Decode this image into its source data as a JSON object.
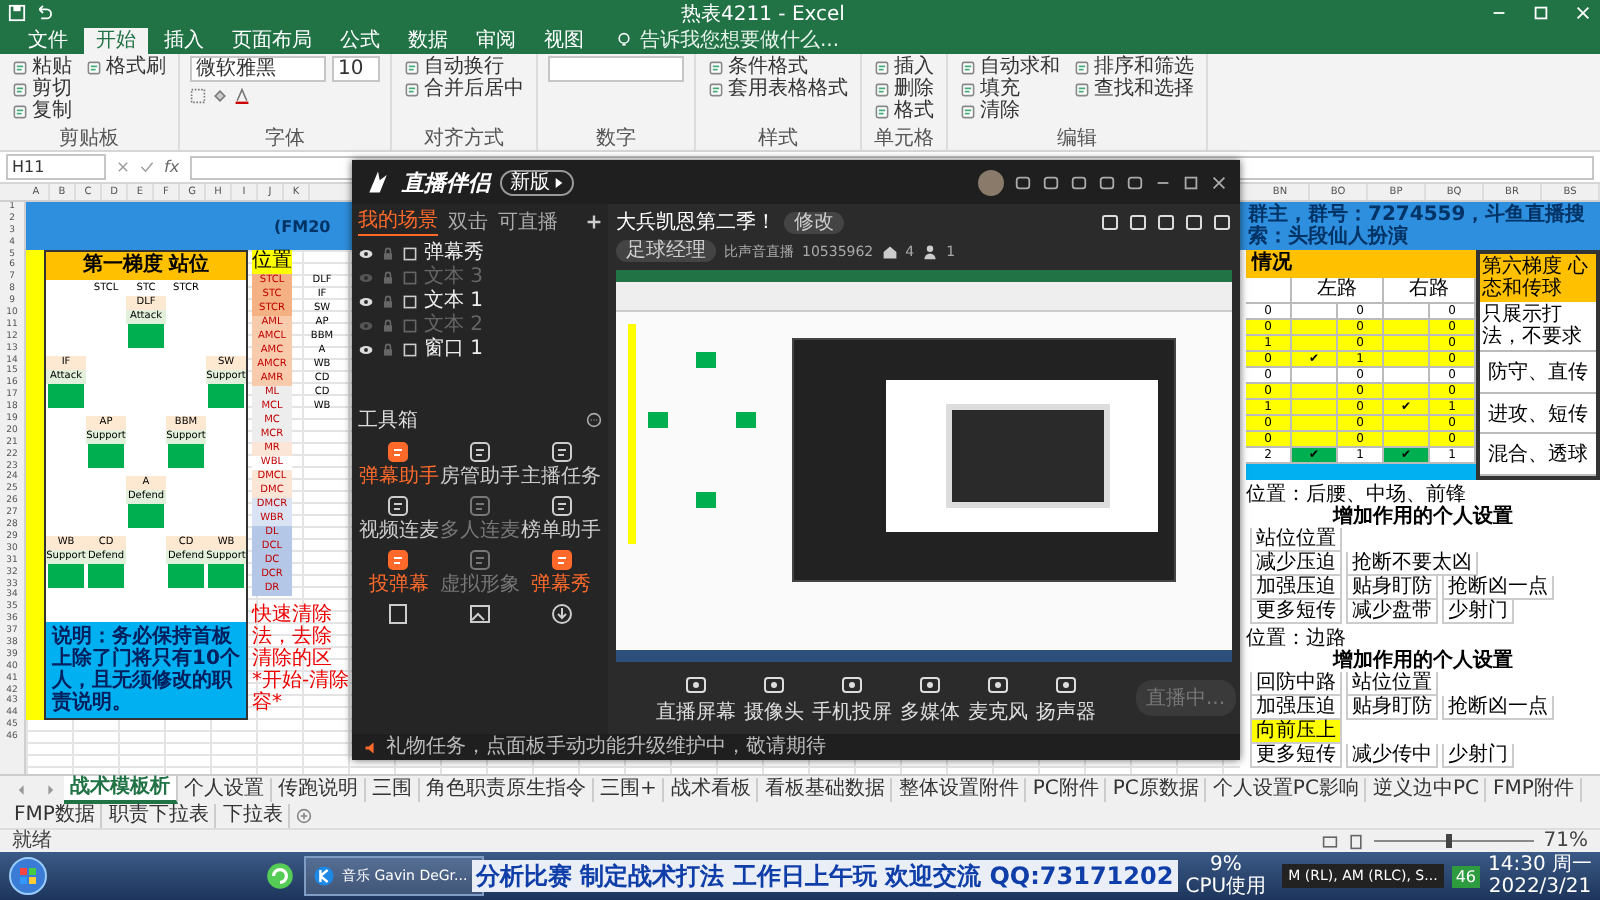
{
  "excel": {
    "title": "热表4211 - Excel",
    "tabs": [
      {
        "label": "文件",
        "selected": false
      },
      {
        "label": "开始",
        "selected": true
      },
      {
        "label": "插入",
        "selected": false
      },
      {
        "label": "页面布局",
        "selected": false
      },
      {
        "label": "公式",
        "selected": false
      },
      {
        "label": "数据",
        "selected": false
      },
      {
        "label": "审阅",
        "selected": false
      },
      {
        "label": "视图",
        "selected": false
      }
    ],
    "tell_me": "告诉我您想要做什么...",
    "ribbon_groups": [
      {
        "label": "剪贴板",
        "buttons": [
          "粘贴",
          "剪切",
          "复制",
          "格式刷"
        ]
      },
      {
        "label": "字体",
        "font": "微软雅黑",
        "size": "10"
      },
      {
        "label": "对齐方式",
        "buttons": [
          "自动换行",
          "合并后居中"
        ]
      },
      {
        "label": "数字"
      },
      {
        "label": "样式",
        "buttons": [
          "条件格式",
          "套用表格格式"
        ]
      },
      {
        "label": "单元格",
        "buttons": [
          "插入",
          "删除",
          "格式"
        ]
      },
      {
        "label": "编辑",
        "buttons": [
          "自动求和",
          "填充",
          "清除",
          "排序和筛选",
          "查找和选择"
        ]
      }
    ],
    "name_box": "H11",
    "fx": "fx",
    "columns_left": [
      "A",
      "B",
      "C",
      "D",
      "E",
      "F",
      "G",
      "H",
      "I",
      "J",
      "K"
    ],
    "columns_right": [
      "BN",
      "BO",
      "BP",
      "BQ",
      "BR",
      "BS"
    ],
    "row_numbers": [
      "1",
      "2",
      "3",
      "4",
      "5",
      "6",
      "7",
      "8",
      "9",
      "10",
      "11",
      "12",
      "13",
      "14",
      "15",
      "16",
      "17",
      "18",
      "19",
      "20",
      "21",
      "22",
      "23",
      "24",
      "25",
      "26",
      "27",
      "28",
      "29",
      "30",
      "31",
      "32",
      "33",
      "34",
      "35",
      "36",
      "37",
      "38",
      "39",
      "40",
      "41",
      "42",
      "43",
      "44",
      "45",
      "46"
    ]
  },
  "sheet": {
    "banner": {
      "left": "(FM20",
      "right": "群主，群号：7274559，斗鱼直播搜索：头段仙人扮演"
    },
    "formation": {
      "title": "第一梯度 站位",
      "header": [
        "STCL",
        "STC",
        "STCR"
      ],
      "lines": [
        {
          "cells": [
            null,
            null,
            {
              "role": "DLF",
              "duty": "Attack"
            },
            null,
            null
          ]
        },
        {
          "cells": [
            {
              "role": "IF",
              "duty": "Attack"
            },
            null,
            null,
            null,
            {
              "role": "SW",
              "duty": "Support"
            }
          ]
        },
        {
          "cells": [
            null,
            {
              "role": "AP",
              "duty": "Support"
            },
            null,
            {
              "role": "BBM",
              "duty": "Support"
            },
            null
          ]
        },
        {
          "cells": [
            null,
            null,
            {
              "role": "A",
              "duty": "Defend"
            },
            null,
            null
          ]
        },
        {
          "cells": [
            {
              "role": "WB",
              "duty": "Support"
            },
            {
              "role": "CD",
              "duty": "Defend"
            },
            null,
            {
              "role": "CD",
              "duty": "Defend"
            },
            {
              "role": "WB",
              "duty": "Support"
            }
          ]
        }
      ],
      "note": "说明：务必保持首板上除了门将只有10个人，且无须修改的职责说明。"
    },
    "positions": {
      "header": "位置",
      "items": [
        {
          "name": "STCL",
          "role": "DLF",
          "color": "#f4b183"
        },
        {
          "name": "STC",
          "role": "IF",
          "color": "#f4b183"
        },
        {
          "name": "STCR",
          "role": "SW",
          "color": "#f4b183"
        },
        {
          "name": "AML",
          "role": "AP",
          "color": "#f8cbad"
        },
        {
          "name": "AMCL",
          "role": "BBM",
          "color": "#f8cbad"
        },
        {
          "name": "AMC",
          "role": "A",
          "color": "#f8cbad"
        },
        {
          "name": "AMCR",
          "role": "WB",
          "color": "#f8cbad"
        },
        {
          "name": "AMR",
          "role": "CD",
          "color": "#f8cbad"
        },
        {
          "name": "ML",
          "role": "CD",
          "color": "#ededed"
        },
        {
          "name": "MCL",
          "role": "WB",
          "color": "#ededed"
        },
        {
          "name": "MC",
          "color": "#ededed"
        },
        {
          "name": "MCR",
          "color": "#ededed"
        },
        {
          "name": "MR",
          "color": "#fbe5d6"
        },
        {
          "name": "WBL",
          "color": "#ffffff"
        },
        {
          "name": "DMCL",
          "color": "#fbe5d6"
        },
        {
          "name": "DMC",
          "color": "#fbe5d6"
        },
        {
          "name": "DMCR",
          "color": "#dae3f3"
        },
        {
          "name": "WBR",
          "color": "#dae3f3"
        },
        {
          "name": "DL",
          "color": "#b4c7e7"
        },
        {
          "name": "DCL",
          "color": "#b4c7e7"
        },
        {
          "name": "DC",
          "color": "#b4c7e7"
        },
        {
          "name": "DCR",
          "color": "#b4c7e7"
        },
        {
          "name": "DR",
          "color": "#b4c7e7"
        }
      ]
    },
    "red_note": [
      "快速清除",
      "法，去除",
      "清除的区",
      "*开始-清除",
      "容*"
    ],
    "summary": {
      "title": "情况",
      "columns": [
        "左路",
        "右路"
      ],
      "rows": [
        {
          "kind": "plain",
          "cells": [
            "0",
            "",
            "0",
            "",
            "0"
          ]
        },
        {
          "kind": "highlight",
          "cells": [
            "0",
            "",
            "0",
            "",
            "0"
          ]
        },
        {
          "kind": "highlight",
          "cells": [
            "1",
            "",
            "0",
            "",
            "0"
          ]
        },
        {
          "kind": "highlight",
          "cells": [
            "0",
            "✔",
            "1",
            "",
            "0"
          ]
        },
        {
          "kind": "plain",
          "cells": [
            "0",
            "",
            "0",
            "",
            "0"
          ]
        },
        {
          "kind": "highlight",
          "cells": [
            "0",
            "",
            "0",
            "",
            "0"
          ]
        },
        {
          "kind": "highlight",
          "cells": [
            "1",
            "",
            "0",
            "✔",
            "1"
          ]
        },
        {
          "kind": "highlight",
          "cells": [
            "0",
            "",
            "0",
            "",
            "0"
          ]
        },
        {
          "kind": "highlight",
          "cells": [
            "0",
            "",
            "0",
            "",
            "0"
          ]
        },
        {
          "kind": "total",
          "cells": [
            "2",
            "✔",
            "1",
            "✔",
            "1"
          ]
        }
      ]
    },
    "styles_panel": {
      "title": "第六梯度 心态和传球",
      "hint": "只展示打法，不要求",
      "styles": [
        "防守、直传",
        "进攻、短传",
        "混合、透球"
      ]
    },
    "sections": [
      {
        "position": "位置：后腰、中场、前锋",
        "header": "增加作用的个人设置",
        "rows": [
          {
            "cells": [
              {
                "text": "站位位置",
                "highlighted": false
              }
            ]
          },
          {
            "cells": [
              {
                "text": "减少压迫",
                "highlighted": false
              },
              {
                "text": "抢断不要太凶",
                "highlighted": false
              }
            ]
          },
          {
            "cells": [
              {
                "text": "加强压迫",
                "highlighted": false
              },
              {
                "text": "贴身盯防",
                "highlighted": false
              },
              {
                "text": "抢断凶一点",
                "highlighted": false
              }
            ]
          },
          {
            "cells": [
              {
                "text": "更多短传",
                "highlighted": false
              },
              {
                "text": "减少盘带",
                "highlighted": false
              },
              {
                "text": "少射门",
                "highlighted": false
              }
            ]
          }
        ]
      },
      {
        "position": "位置：边路",
        "header": "增加作用的个人设置",
        "rows": [
          {
            "cells": [
              {
                "text": "回防中路",
                "highlighted": false
              },
              {
                "text": "站位位置",
                "highlighted": false
              }
            ]
          },
          {
            "cells": [
              {
                "text": "加强压迫",
                "highlighted": false
              },
              {
                "text": "贴身盯防",
                "highlighted": false
              },
              {
                "text": "抢断凶一点",
                "highlighted": false
              }
            ]
          },
          {
            "cells": [
              {
                "text": "向前压上",
                "highlighted": true
              }
            ]
          },
          {
            "cells": [
              {
                "text": "更多短传",
                "highlighted": false
              },
              {
                "text": "减少传中",
                "highlighted": false
              },
              {
                "text": "少射门",
                "highlighted": false
              }
            ]
          }
        ]
      }
    ]
  },
  "stream": {
    "app_name": "直播伴侣",
    "version_button": "新版",
    "scene_tabs": [
      {
        "label": "我的场景",
        "selected": true
      },
      {
        "label": "双击",
        "selected": false
      },
      {
        "label": "可直播",
        "selected": false
      }
    ],
    "sources": [
      {
        "name": "弹幕秀",
        "visible": true
      },
      {
        "name": "文本 3",
        "visible": false
      },
      {
        "name": "文本 1",
        "visible": true
      },
      {
        "name": "文本 2",
        "visible": false
      },
      {
        "name": "窗口 1",
        "visible": true
      }
    ],
    "toolbox_title": "工具箱",
    "tools": [
      {
        "label": "弹幕助手",
        "highlighted": true,
        "disabled": false
      },
      {
        "label": "房管助手",
        "highlighted": false,
        "disabled": false
      },
      {
        "label": "主播任务",
        "highlighted": false,
        "disabled": false
      },
      {
        "label": "视频连麦",
        "highlighted": false,
        "disabled": false
      },
      {
        "label": "多人连麦",
        "highlighted": false,
        "disabled": true
      },
      {
        "label": "榜单助手",
        "highlighted": false,
        "disabled": false
      },
      {
        "label": "投弹幕",
        "highlighted": true,
        "disabled": false
      },
      {
        "label": "虚拟形象",
        "highlighted": false,
        "disabled": true
      },
      {
        "label": "弹幕秀",
        "highlighted": true,
        "disabled": false
      }
    ],
    "room_title": "大兵凯恩第二季！",
    "edit_button": "修改",
    "category": "足球经理",
    "room_label": "比声音直播",
    "room_id": "10535962",
    "fans": "4",
    "viewers": "1",
    "controls": [
      "直播屏幕",
      "摄像头",
      "手机投屏",
      "多媒体",
      "麦克风",
      "扬声器"
    ],
    "live_button": "直播中...",
    "notice": "礼物任务，点面板手动功能升级维护中，敬请期待"
  },
  "sheet_tabs": [
    {
      "label": "战术模板析",
      "selected": true
    },
    {
      "label": "个人设置",
      "selected": false
    },
    {
      "label": "传跑说明",
      "selected": false
    },
    {
      "label": "三围",
      "selected": false
    },
    {
      "label": "角色职责原生指令",
      "selected": false
    },
    {
      "label": "三围+",
      "selected": false
    },
    {
      "label": "战术看板",
      "selected": false
    },
    {
      "label": "看板基础数据",
      "selected": false
    },
    {
      "label": "整体设置附件",
      "selected": false
    },
    {
      "label": "PC附件",
      "selected": false
    },
    {
      "label": "PC原数据",
      "selected": false
    },
    {
      "label": "个人设置PC影响",
      "selected": false
    },
    {
      "label": "逆义边中PC",
      "selected": false
    },
    {
      "label": "FMP附件",
      "selected": false
    },
    {
      "label": "FMP数据",
      "selected": false
    },
    {
      "label": "职责下拉表",
      "selected": false
    },
    {
      "label": "下拉表",
      "selected": false
    }
  ],
  "status_bar": {
    "state": "就绪",
    "zoom": "71%",
    "level": 0.45
  },
  "taskbar": {
    "window_button": "音乐 Gavin DeGr...",
    "overlay_text": "分析比赛 制定战术打法 工作日上午玩 欢迎交流 QQ:73171202",
    "cpu": "9%",
    "cpu_label": "CPU使用",
    "media": "M (RL), AM (RLC), S...",
    "badge": "46",
    "time": "14:30 周一",
    "date": "2022/3/21"
  }
}
